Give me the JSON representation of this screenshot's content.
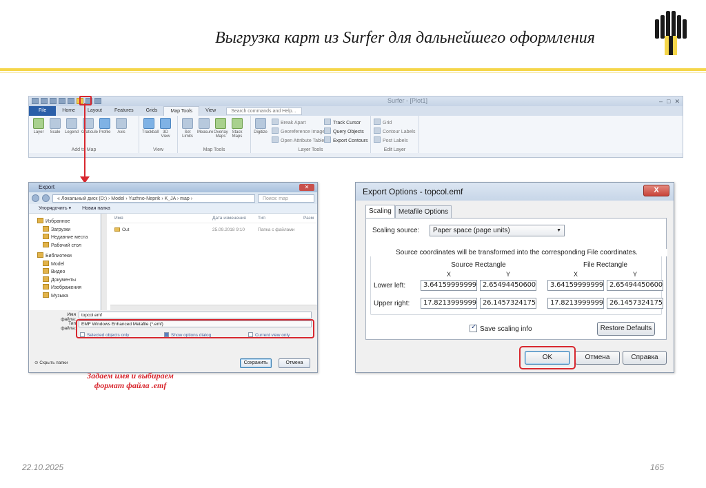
{
  "slide": {
    "title": "Выгрузка карт из Surfer для дальнейшего оформления",
    "date": "22.10.2025",
    "page_number": "165",
    "accent_color": "#f5d64a",
    "highlight_color": "#d8272e"
  },
  "ribbon": {
    "app_title": "Surfer - [Plot1]",
    "tabs": [
      "File",
      "Home",
      "Layout",
      "Features",
      "Grids",
      "Map Tools",
      "View"
    ],
    "active_tab": "Map Tools",
    "search_placeholder": "Search commands and Help...",
    "groups": {
      "add_to_map": {
        "label": "Add to Map",
        "items": [
          "Layer",
          "Scale",
          "Legend",
          "Graticule",
          "Profile",
          "Axis"
        ]
      },
      "view": {
        "label": "View",
        "items": [
          "Trackball",
          "3D View"
        ]
      },
      "map_tools": {
        "label": "Map Tools",
        "items": [
          "Set Limits",
          "Measure",
          "Overlay Maps",
          "Stack Maps"
        ]
      },
      "layer_tools": {
        "label": "Layer Tools",
        "digitize": "Digitize",
        "col1": [
          "Break Apart",
          "Georeference Image",
          "Open Attribute Table"
        ],
        "col2": [
          "Track Cursor",
          "Query Objects",
          "Export Contours"
        ]
      },
      "edit_layer": {
        "label": "Edit Layer",
        "items": [
          "Grid",
          "Contour Labels",
          "Post Labels"
        ]
      }
    }
  },
  "export_dialog": {
    "title": "Export",
    "address_path": "« Локальный диск (D:) › Model › Yuzhno-Neprik › K_JA › map ›",
    "search_placeholder": "Поиск: map",
    "toolbar": {
      "organize": "Упорядочить ▾",
      "new_folder": "Новая папка"
    },
    "nav": {
      "favorites": "Избранное",
      "favorites_items": [
        "Загрузки",
        "Недавние места",
        "Рабочий стол"
      ],
      "libraries": "Библиотеки",
      "libraries_items": [
        "Model",
        "Видео",
        "Документы",
        "Изображения",
        "Музыка"
      ]
    },
    "columns": {
      "name": "Имя",
      "date": "Дата изменения",
      "type": "Тип",
      "size": "Разм"
    },
    "files": [
      {
        "name": "Out",
        "date": "25.09.2018 9:10",
        "type": "Папка с файлами"
      }
    ],
    "file_name_label": "Имя файла:",
    "file_name_value": "topcol.emf",
    "file_type_label": "Тип файла:",
    "file_type_value": "EMF Windows Enhanced Metafile (*.emf)",
    "checkboxes": [
      {
        "label": "Selected objects only",
        "checked": false
      },
      {
        "label": "Show options dialog",
        "checked": true
      },
      {
        "label": "Current view only",
        "checked": false
      }
    ],
    "hide_folders": "Скрыть папки",
    "save_button": "Сохранить",
    "cancel_button": "Отмена"
  },
  "caption": {
    "line1": "Задаем имя и выбираем",
    "line2": "формат файла .emf"
  },
  "options_dialog": {
    "title": "Export Options - topcol.emf",
    "close_label": "X",
    "tabs": [
      "Scaling",
      "Metafile Options"
    ],
    "active_tab": "Scaling",
    "scaling_source_label": "Scaling source:",
    "scaling_source_value": "Paper space (page units)",
    "description": "Source coordinates will be transformed into the corresponding File coordinates.",
    "source_rect_label": "Source Rectangle",
    "file_rect_label": "File Rectangle",
    "x_label": "X",
    "y_label": "Y",
    "lower_left_label": "Lower left:",
    "upper_right_label": "Upper right:",
    "source": {
      "lower_left": {
        "x": "3.6415999999998",
        "y": "2.6549445060000"
      },
      "upper_right": {
        "x": "17.821399999999",
        "y": "26.145732417547"
      }
    },
    "file": {
      "lower_left": {
        "x": "3.6415999999998",
        "y": "2.6549445060000"
      },
      "upper_right": {
        "x": "17.821399999999",
        "y": "26.145732417547"
      }
    },
    "save_scaling_label": "Save scaling info",
    "save_scaling_checked": true,
    "restore_defaults": "Restore Defaults",
    "ok": "OK",
    "cancel": "Отмена",
    "help": "Справка"
  }
}
